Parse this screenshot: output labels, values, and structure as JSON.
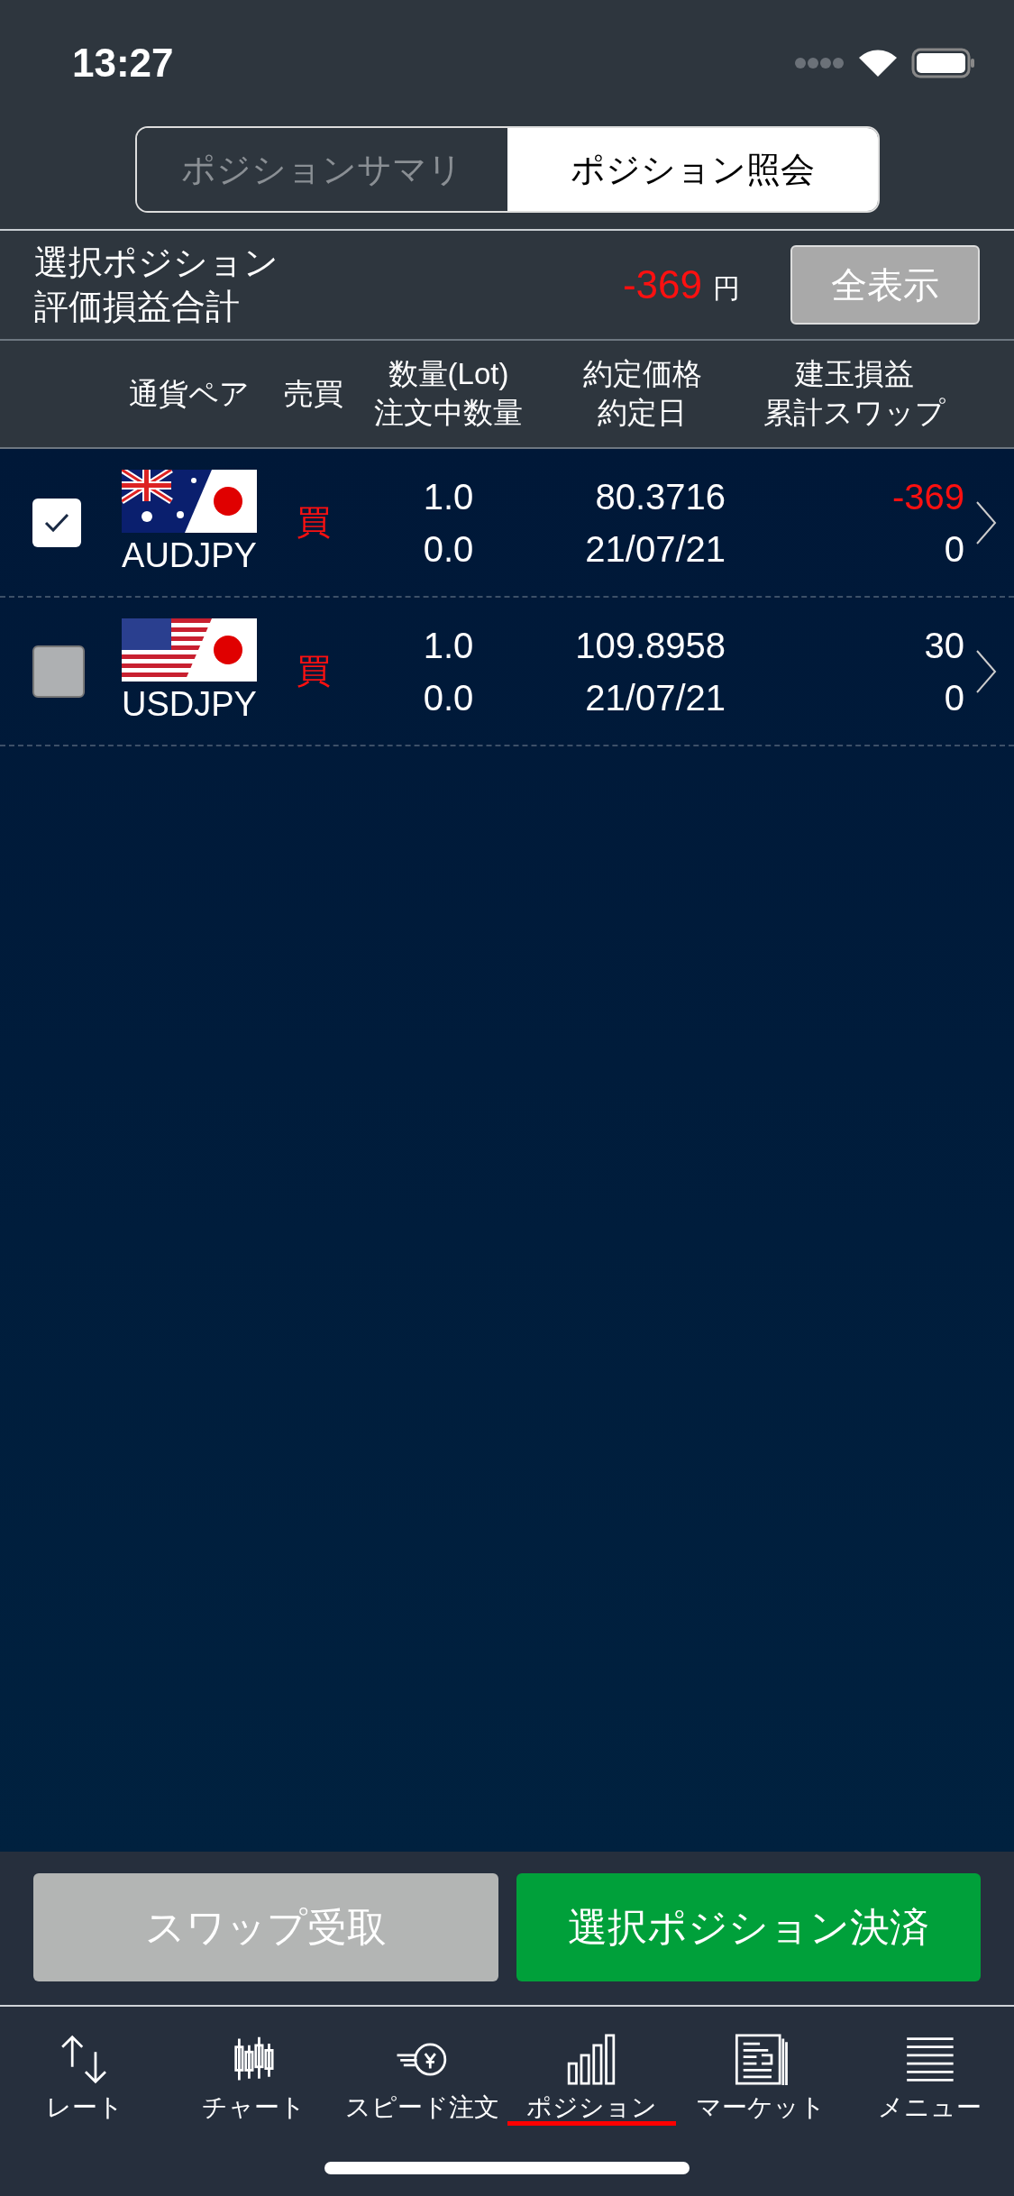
{
  "status_bar": {
    "time": "13:27"
  },
  "segments": [
    {
      "label": "ポジションサマリ",
      "selected": false
    },
    {
      "label": "ポジション照会",
      "selected": true
    }
  ],
  "summary": {
    "label_line1": "選択ポジション",
    "label_line2": "評価損益合計",
    "value": "-369",
    "unit": "円",
    "button": "全表示"
  },
  "columns": [
    {
      "line1": "通貨ペア"
    },
    {
      "line1": "売買"
    },
    {
      "line1": "数量(Lot)",
      "line2": "注文中数量"
    },
    {
      "line1": "約定価格",
      "line2": "約定日"
    },
    {
      "line1": "建玉損益",
      "line2": "累計スワップ"
    }
  ],
  "rows": [
    {
      "checked": true,
      "kind": "au",
      "pair": "AUDJPY",
      "side": "買",
      "lot": "1.0",
      "pending": "0.0",
      "price": "80.3716",
      "date": "21/07/21",
      "pl": "-369",
      "loss": true,
      "swap": "0"
    },
    {
      "checked": false,
      "kind": "us",
      "pair": "USDJPY",
      "side": "買",
      "lot": "1.0",
      "pending": "0.0",
      "price": "109.8958",
      "date": "21/07/21",
      "pl": "30",
      "loss": false,
      "swap": "0"
    }
  ],
  "actions": [
    {
      "label": "スワップ受取",
      "kind": "secondary"
    },
    {
      "label": "選択ポジション決済",
      "kind": "primary"
    }
  ],
  "tabs": [
    {
      "label": "レート",
      "kind": "arrows",
      "selected": false
    },
    {
      "label": "チャート",
      "kind": "candles",
      "selected": false
    },
    {
      "label": "スピード注文",
      "kind": "speed",
      "selected": false
    },
    {
      "label": "ポジション",
      "kind": "bars",
      "selected": true
    },
    {
      "label": "マーケット",
      "kind": "news",
      "selected": false
    },
    {
      "label": "メニュー",
      "kind": "menu",
      "selected": false
    }
  ]
}
